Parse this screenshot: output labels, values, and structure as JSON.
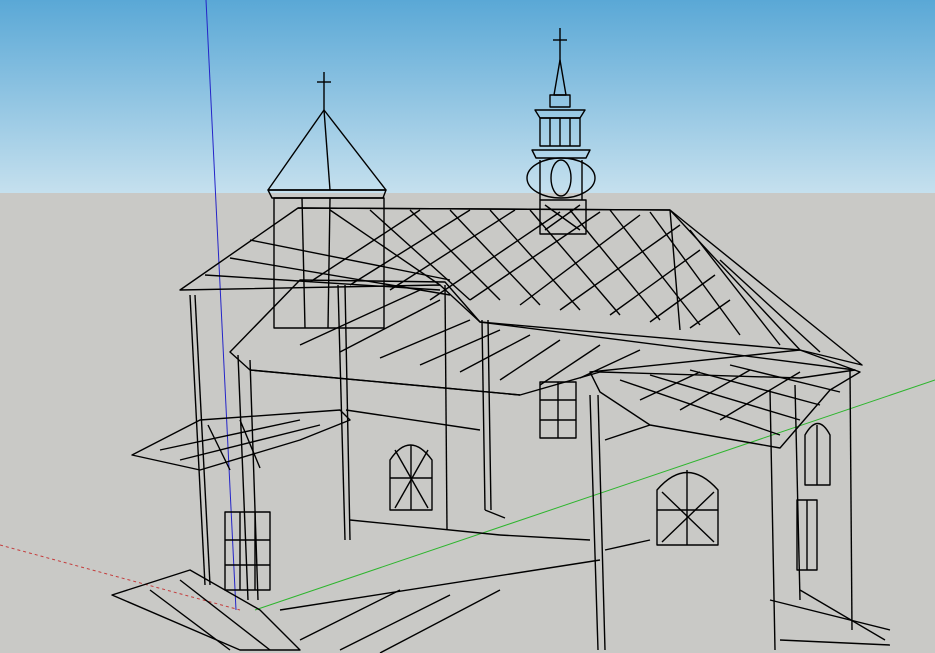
{
  "app": {
    "view": "3d-modeling-viewport",
    "render_style": "wireframe"
  },
  "colors": {
    "sky_top": "#5aa8d6",
    "sky_bottom": "#c5e0ee",
    "ground": "#c9c9c6",
    "edge": "#000000",
    "axis_red": "#c43c3c",
    "axis_green": "#2db52d",
    "axis_blue": "#2424c8"
  },
  "model": {
    "name": "wooden-church",
    "parts": [
      "main-roof",
      "tower-left",
      "bell-turret",
      "porch-roof",
      "side-porch",
      "windows",
      "drain-pipe",
      "entrance-door",
      "base-platform"
    ]
  }
}
